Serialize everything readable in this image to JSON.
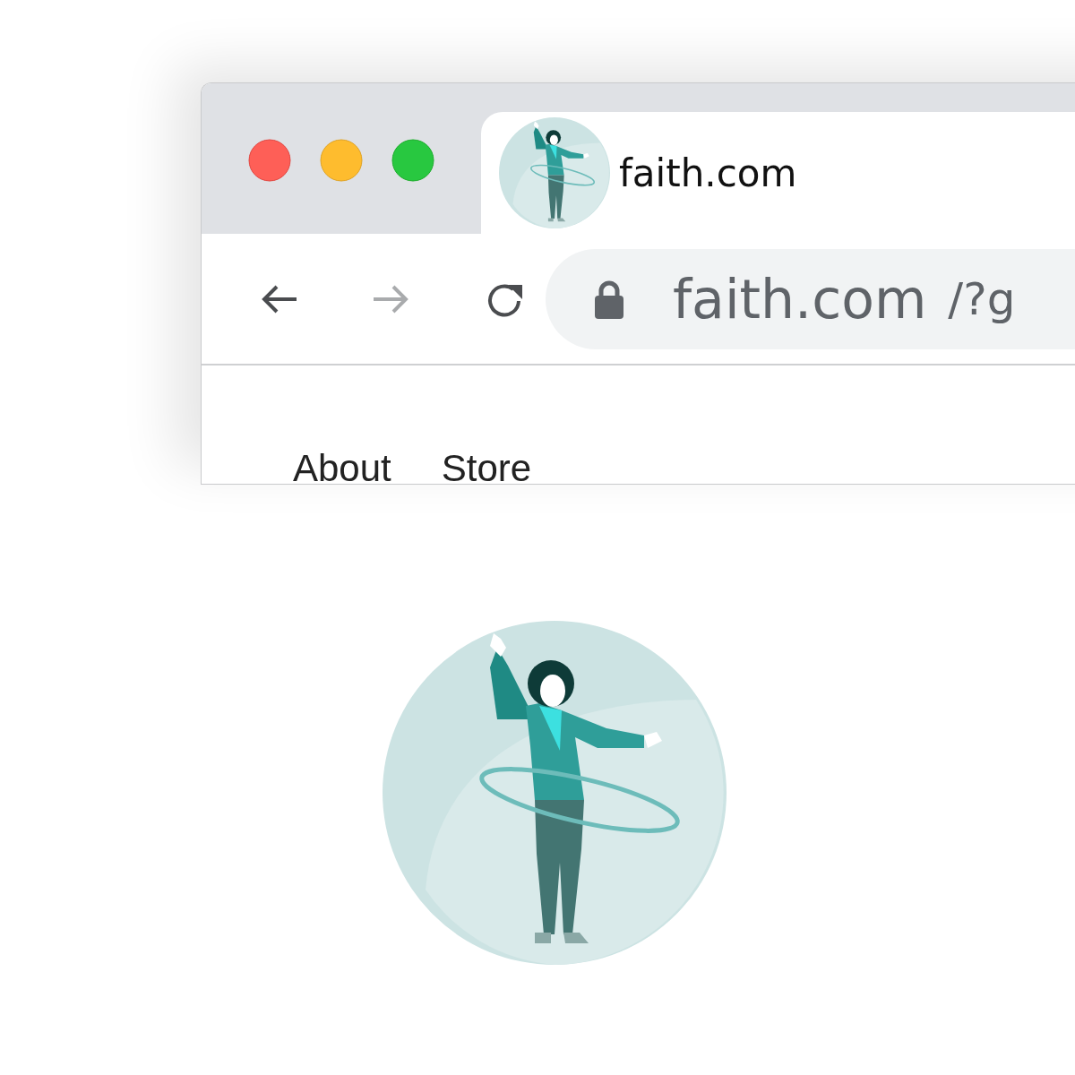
{
  "tab": {
    "title": "faith.com",
    "selected": true
  },
  "toolbar": {
    "buttons": [
      {
        "kind": "back",
        "disabled": false
      },
      {
        "kind": "forward",
        "disabled": true
      },
      {
        "kind": "reload",
        "disabled": false
      }
    ]
  },
  "address_bar": {
    "host": "faith.com",
    "path": "/?g"
  },
  "nav_links": [
    "About",
    "Store"
  ]
}
